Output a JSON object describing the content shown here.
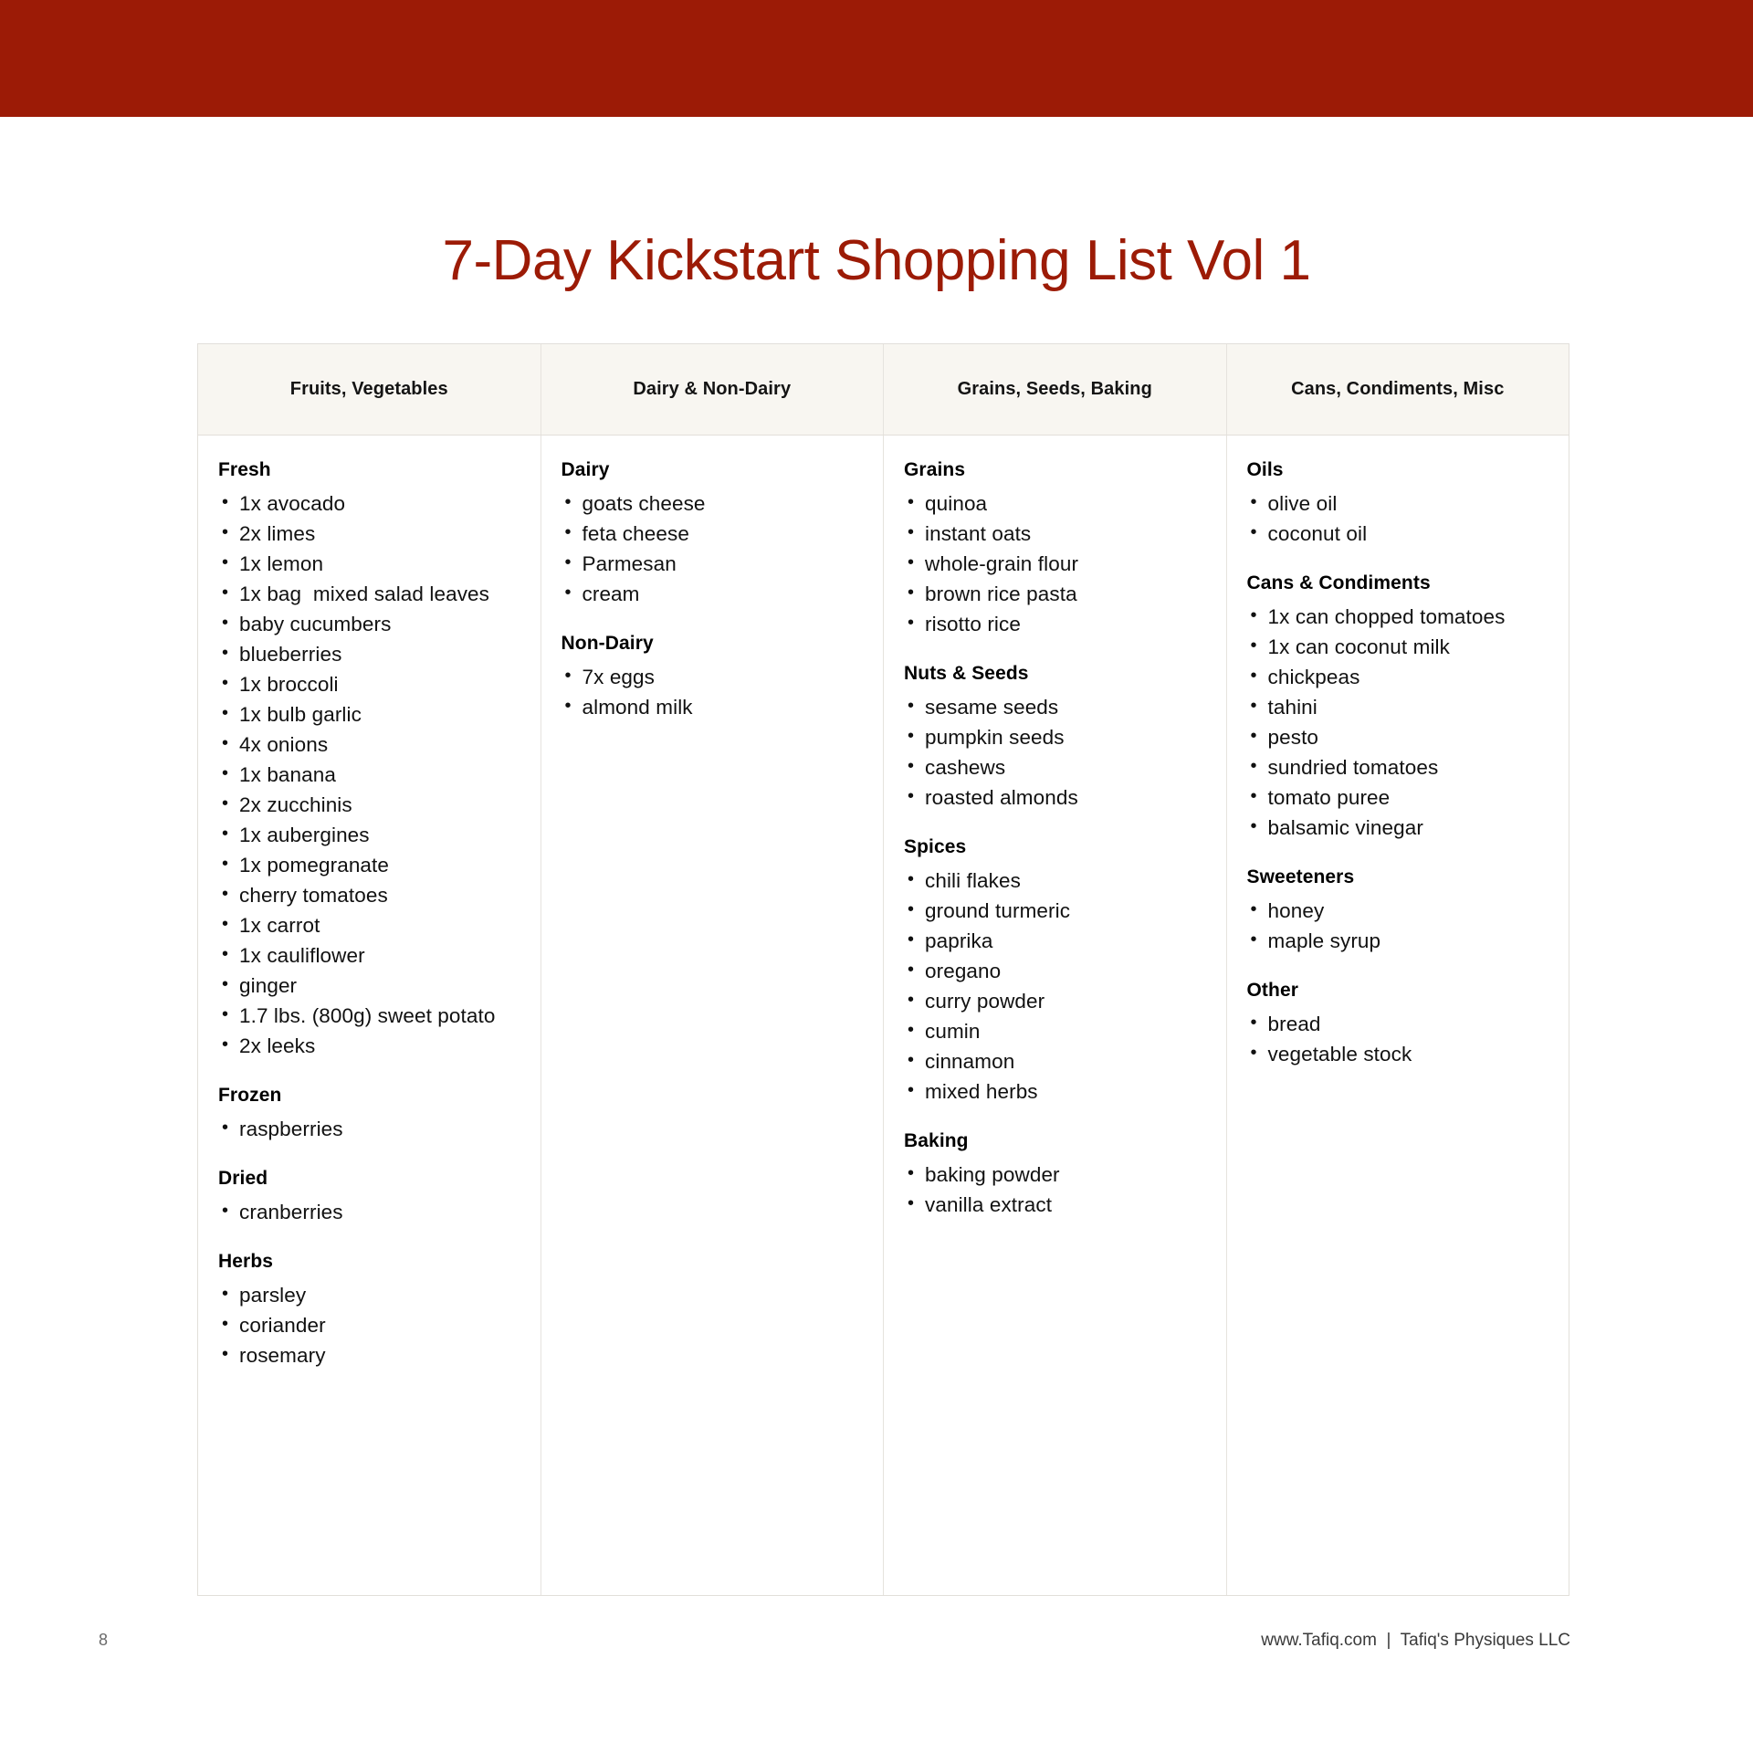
{
  "theme": {
    "banner_color": "#9C1B06",
    "title_color": "#9C1B06",
    "header_bg": "#F8F6F1",
    "border_color": "#E2DFDA"
  },
  "document": {
    "title": "7-Day Kickstart Shopping List Vol 1"
  },
  "table": {
    "columns": [
      {
        "header": "Fruits, Vegetables",
        "groups": [
          {
            "title": "Fresh",
            "items": [
              "1x avocado",
              "2x limes",
              "1x lemon",
              "1x bag  mixed salad leaves",
              "baby cucumbers",
              "blueberries",
              "1x broccoli",
              "1x bulb garlic",
              "4x onions",
              "1x banana",
              "2x zucchinis",
              "1x aubergines",
              "1x pomegranate",
              "cherry tomatoes",
              "1x carrot",
              "1x cauliflower",
              "ginger",
              "1.7 lbs. (800g) sweet potato",
              "2x leeks"
            ]
          },
          {
            "title": "Frozen",
            "items": [
              "raspberries"
            ]
          },
          {
            "title": "Dried",
            "items": [
              "cranberries"
            ]
          },
          {
            "title": "Herbs",
            "items": [
              "parsley",
              "coriander",
              "rosemary"
            ]
          }
        ]
      },
      {
        "header": "Dairy & Non-Dairy",
        "groups": [
          {
            "title": "Dairy",
            "items": [
              "goats cheese",
              "feta cheese",
              "Parmesan",
              "cream"
            ]
          },
          {
            "title": "Non-Dairy",
            "items": [
              "7x eggs",
              "almond milk"
            ]
          }
        ]
      },
      {
        "header": "Grains, Seeds, Baking",
        "groups": [
          {
            "title": "Grains",
            "items": [
              "quinoa",
              "instant oats",
              "whole-grain flour",
              "brown rice pasta",
              "risotto rice"
            ]
          },
          {
            "title": "Nuts & Seeds",
            "items": [
              "sesame seeds",
              "pumpkin seeds",
              "cashews",
              "roasted almonds"
            ]
          },
          {
            "title": "Spices",
            "items": [
              "chili flakes",
              "ground turmeric",
              "paprika",
              "oregano",
              "curry powder",
              "cumin",
              "cinnamon",
              "mixed herbs"
            ]
          },
          {
            "title": "Baking",
            "items": [
              "baking powder",
              "vanilla extract"
            ]
          }
        ]
      },
      {
        "header": "Cans, Condiments, Misc",
        "groups": [
          {
            "title": "Oils",
            "items": [
              "olive oil",
              "coconut oil"
            ]
          },
          {
            "title": "Cans & Condiments",
            "items": [
              "1x can chopped tomatoes",
              "1x can coconut milk",
              "chickpeas",
              "tahini",
              "pesto",
              "sundried tomatoes",
              "tomato puree",
              "balsamic vinegar"
            ]
          },
          {
            "title": "Sweeteners",
            "items": [
              "honey",
              "maple syrup"
            ]
          },
          {
            "title": "Other",
            "items": [
              "bread",
              "vegetable stock"
            ]
          }
        ]
      }
    ]
  },
  "footer": {
    "page_number": "8",
    "credit": "www.Tafiq.com  |  Tafiq's Physiques LLC"
  }
}
